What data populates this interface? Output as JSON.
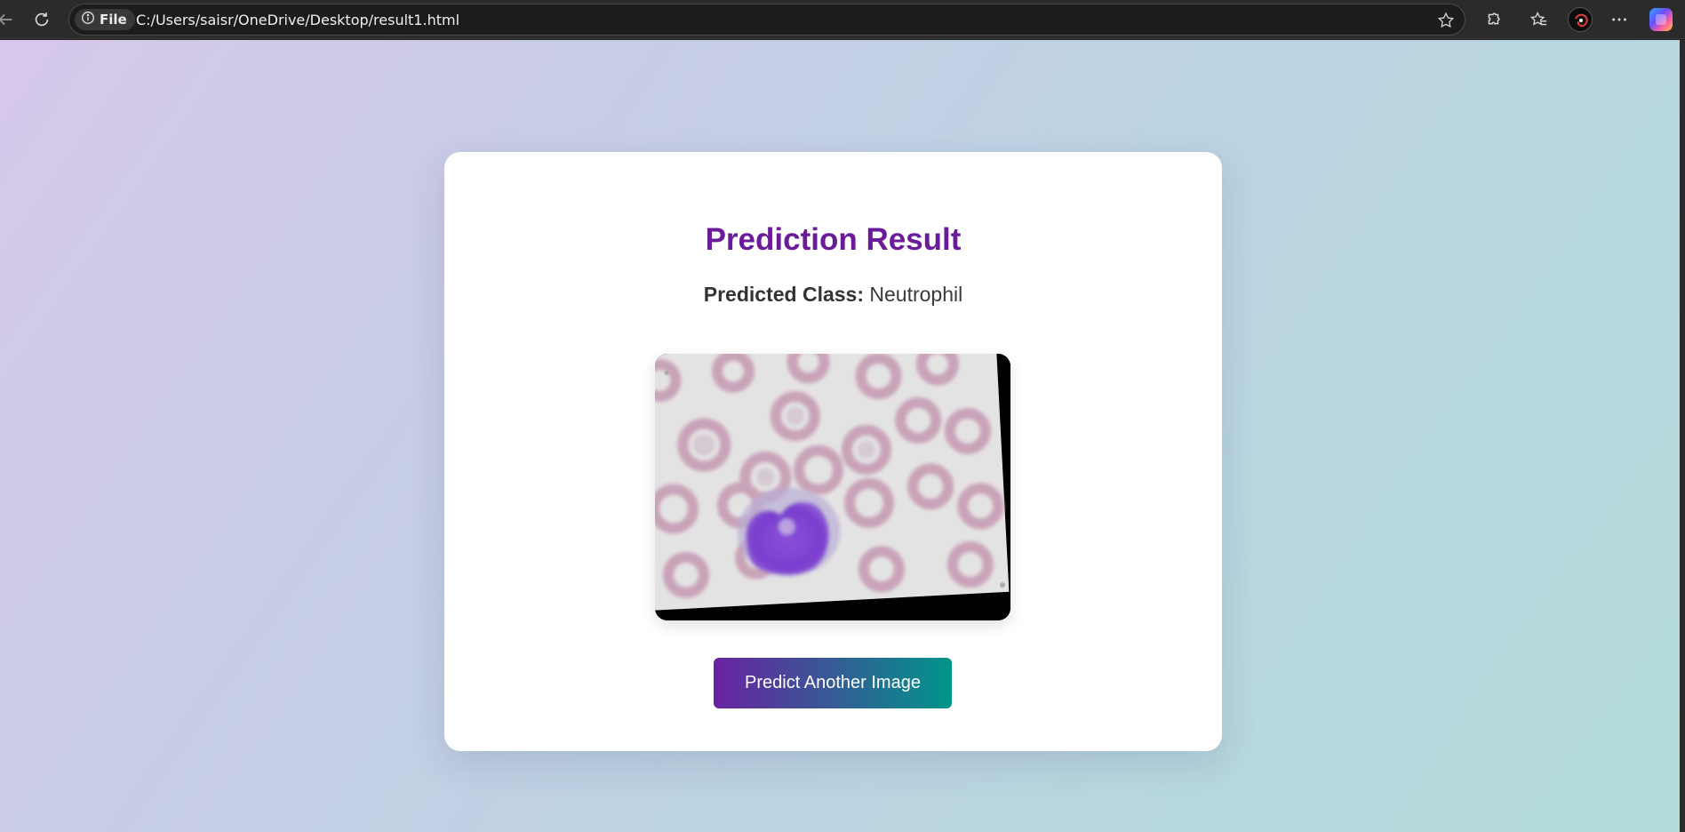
{
  "browser": {
    "site_label": "File",
    "url": "C:/Users/saisr/OneDrive/Desktop/result1.html"
  },
  "page": {
    "title": "Prediction Result",
    "predicted_label": "Predicted Class:",
    "predicted_value": "Neutrophil",
    "button_label": "Predict Another Image"
  },
  "icons": {
    "back": "back-arrow-icon",
    "reload": "reload-icon",
    "info": "info-icon",
    "favorite": "star-icon",
    "extensions": "puzzle-icon",
    "favorites": "favorites-icon",
    "more": "more-icon",
    "copilot": "copilot-icon"
  },
  "colors": {
    "title": "#6a1b9a",
    "button_start": "#6a22a0",
    "button_end": "#00958a"
  }
}
